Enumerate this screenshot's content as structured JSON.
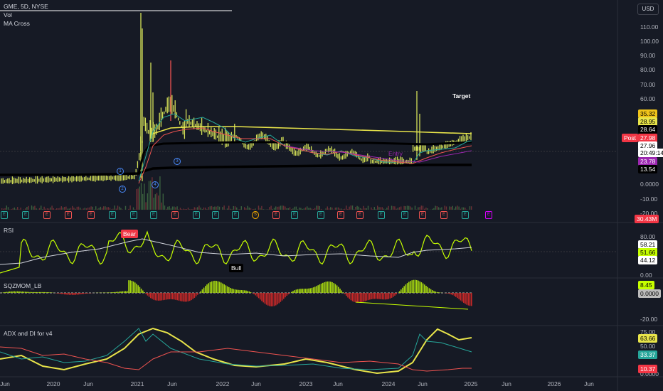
{
  "header": {
    "symbol_line": "GME, 5D, NYSE",
    "indicators": [
      "Vol",
      "MA Cross"
    ],
    "currency_button": "USD"
  },
  "main_pane": {
    "price_ticks": [
      "110.00",
      "100.00",
      "90.00",
      "80.00",
      "70.00",
      "60.00",
      "0.0000",
      "-10.00",
      "-20.00"
    ],
    "annotations": {
      "target": "Target",
      "entry": "Entry"
    },
    "wave_labels": [
      "1",
      "2",
      "3",
      "4",
      "5"
    ],
    "badges": {
      "b1": "35.32",
      "b2": "28.95",
      "b3": "28.64",
      "post_label": "Post",
      "post_value": "27.98",
      "price": "27.96",
      "countdown": "20:49:14",
      "b4": "23.78",
      "b5": "13.54",
      "vol": "30.43M"
    },
    "earnings_marker": "E",
    "dividend_marker": "S"
  },
  "rsi_pane": {
    "title": "RSI",
    "ticks": [
      "80.00",
      "0.00"
    ],
    "badges": {
      "v1": "58.21",
      "v2": "51.66",
      "v3": "44.12"
    },
    "labels": {
      "bear": "Bear",
      "bull": "Bull"
    }
  },
  "sqz_pane": {
    "title": "SQZMOM_LB",
    "ticks": [
      "-20.00"
    ],
    "badges": {
      "v1": "8.45",
      "v2": "0.0000"
    }
  },
  "adx_pane": {
    "title": "ADX and DI for v4",
    "ticks": [
      "75.00",
      "50.00",
      "0.0000"
    ],
    "badges": {
      "adx": "63.66",
      "di_plus": "33.37",
      "di_minus": "10.37"
    }
  },
  "time_axis": [
    "Jun",
    "2020",
    "Jun",
    "2021",
    "Jun",
    "2022",
    "Jun",
    "2023",
    "Jun",
    "2024",
    "Jun",
    "2025",
    "Jun",
    "2026",
    "Jun"
  ],
  "colors": {
    "background": "#161a25",
    "candle": "#d4e157",
    "ma_yellow": "#e8e44a",
    "ma_black": "#000000",
    "green_line": "#26a69a",
    "red_line": "#ef5350",
    "purple": "#9c27b0",
    "rsi_line": "#c6ff00",
    "post_red": "#f23645"
  }
}
